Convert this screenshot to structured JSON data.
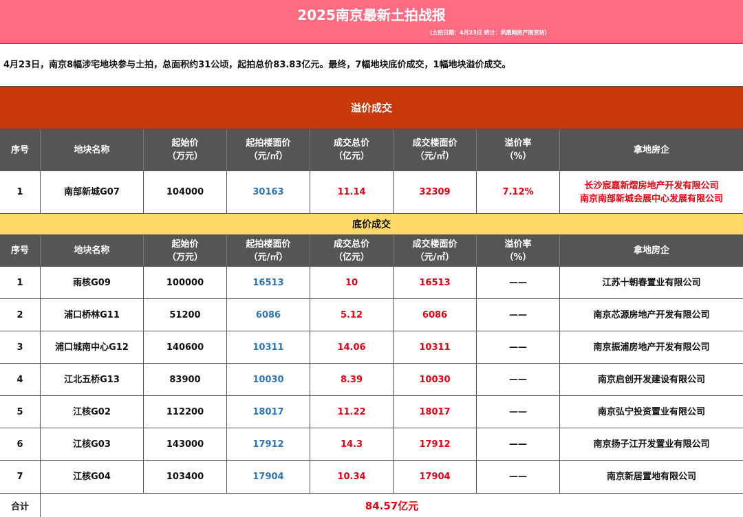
{
  "header": {
    "title": "2025南京最新土拍战报",
    "subtitle": "（土拍日期：4月23日  统计：凤凰网房产南京站）"
  },
  "summary": "4月23日，南京8幅涉宅地块参与土拍，总面积约31公顷，起拍总价83.83亿元。最终，7幅地块底价成交，1幅地块溢价成交。",
  "columns": {
    "index": "序号",
    "name": "地块名称",
    "start_price": [
      "起始价",
      "（万元）"
    ],
    "start_floor_price": [
      "起拍楼面价",
      "（元/㎡）"
    ],
    "deal_total": [
      "成交总价",
      "（亿元）"
    ],
    "deal_floor_price": [
      "成交楼面价",
      "（元/㎡）"
    ],
    "premium_rate": [
      "溢价率",
      "（%）"
    ],
    "buyer": "拿地房企"
  },
  "premium_section": {
    "title": "溢价成交",
    "rows": [
      {
        "index": "1",
        "name": "南部新城G07",
        "start_price": "104000",
        "start_floor_price": "30163",
        "deal_total": "11.14",
        "deal_floor_price": "32309",
        "premium_rate": "7.12%",
        "buyer_lines": [
          "长沙宸嘉新熠房地产开发有限公司",
          "南京南部新城会展中心发展有限公司"
        ]
      }
    ]
  },
  "base_section": {
    "title": "底价成交",
    "rows": [
      {
        "index": "1",
        "name": "雨核G09",
        "start_price": "100000",
        "start_floor_price": "16513",
        "deal_total": "10",
        "deal_floor_price": "16513",
        "premium_rate": "——",
        "buyer": "江苏十朝春置业有限公司"
      },
      {
        "index": "2",
        "name": "浦口桥林G11",
        "start_price": "51200",
        "start_floor_price": "6086",
        "deal_total": "5.12",
        "deal_floor_price": "6086",
        "premium_rate": "——",
        "buyer": "南京芯源房地产开发有限公司"
      },
      {
        "index": "3",
        "name": "浦口城南中心G12",
        "start_price": "140600",
        "start_floor_price": "10311",
        "deal_total": "14.06",
        "deal_floor_price": "10311",
        "premium_rate": "——",
        "buyer": "南京振浦房地产开发有限公司"
      },
      {
        "index": "4",
        "name": "江北五桥G13",
        "start_price": "83900",
        "start_floor_price": "10030",
        "deal_total": "8.39",
        "deal_floor_price": "10030",
        "premium_rate": "——",
        "buyer": "南京启创开发建设有限公司"
      },
      {
        "index": "5",
        "name": "江核G02",
        "start_price": "112200",
        "start_floor_price": "18017",
        "deal_total": "11.22",
        "deal_floor_price": "18017",
        "premium_rate": "——",
        "buyer": "南京弘宁投资置业有限公司"
      },
      {
        "index": "6",
        "name": "江核G03",
        "start_price": "143000",
        "start_floor_price": "17912",
        "deal_total": "14.3",
        "deal_floor_price": "17912",
        "premium_rate": "——",
        "buyer": "南京扬子江开发置业有限公司"
      },
      {
        "index": "7",
        "name": "江核G04",
        "start_price": "103400",
        "start_floor_price": "17904",
        "deal_total": "10.34",
        "deal_floor_price": "17904",
        "premium_rate": "——",
        "buyer": "南京新居置地有限公司"
      }
    ]
  },
  "total": {
    "label": "合计",
    "value": "84.57亿元"
  },
  "colors": {
    "title_bg": "#ff6b81",
    "premium_bg": "#c8390a",
    "base_bg": "#ffd966",
    "header_bg": "#555555",
    "blue_text": "#2e75b6",
    "red_text": "#e60012"
  }
}
